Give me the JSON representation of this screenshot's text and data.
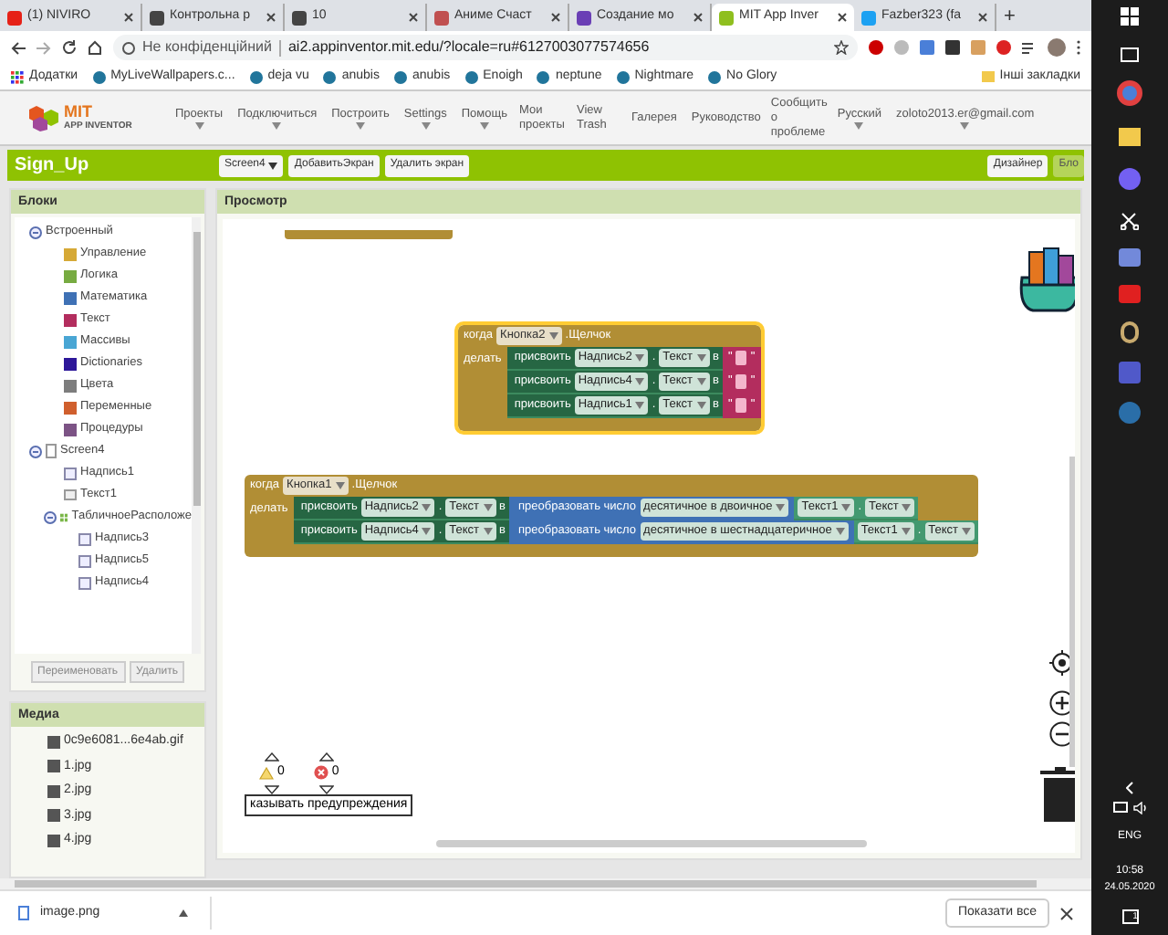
{
  "browser": {
    "tabs": [
      {
        "title": "(1) NIVIRO",
        "selected": false,
        "color": "#e62117"
      },
      {
        "title": "Контрольна р",
        "selected": false,
        "color": "#444444"
      },
      {
        "title": "10",
        "selected": false,
        "color": "#444444"
      },
      {
        "title": "Аниме Счаст",
        "selected": false,
        "color": "#c05050"
      },
      {
        "title": "Создание мо",
        "selected": false,
        "color": "#6a3fb5"
      },
      {
        "title": "MIT App Inver",
        "selected": true,
        "color": "#8fbf1f"
      },
      {
        "title": "Fazber323 (fa",
        "selected": false,
        "color": "#1da1f2"
      }
    ],
    "new_tab": "+",
    "security": "Не конфіденційний",
    "url": "ai2.appinventor.mit.edu/?locale=ru#6127003077574656",
    "apps": "Додатки",
    "bookmarks": [
      "MyLiveWallpapers.c...",
      "deja vu",
      "anubis",
      "anubis",
      "Enoigh",
      "neptune",
      "Nightmare",
      "No Glory"
    ],
    "other_bookmarks": "Інші закладки"
  },
  "app": {
    "logo": {
      "line1": "MIT",
      "line2": "APP INVENTOR"
    },
    "menu": [
      {
        "label": "Проекты",
        "dropdown": true
      },
      {
        "label": "Подключиться",
        "dropdown": true
      },
      {
        "label": "Построить",
        "dropdown": true
      },
      {
        "label": "Settings",
        "dropdown": true
      },
      {
        "label": "Помощь",
        "dropdown": true
      },
      {
        "label": "Мои проекты",
        "dropdown": false
      },
      {
        "label": "View Trash",
        "dropdown": false
      },
      {
        "label": "Галерея",
        "dropdown": false
      },
      {
        "label": "Руководство",
        "dropdown": false
      },
      {
        "label": "Сообщить о проблеме",
        "dropdown": false
      },
      {
        "label": "Русский",
        "dropdown": true
      },
      {
        "label": "zoloto2013.er@gmail.com",
        "dropdown": true
      }
    ]
  },
  "toolbar": {
    "project": "Sign_Up",
    "screen": "Screen4",
    "buttons": [
      "ДобавитьЭкран",
      "Удалить экран"
    ],
    "modes": [
      {
        "label": "Дизайнер",
        "selected": false
      },
      {
        "label": "Бло",
        "selected": true
      }
    ]
  },
  "blocks_panel": {
    "title": "Блоки",
    "tree": [
      {
        "label": "Встроенный",
        "expanded": true,
        "children": [
          {
            "label": "Управление",
            "color": "#d6a936"
          },
          {
            "label": "Логика",
            "color": "#77ab41"
          },
          {
            "label": "Математика",
            "color": "#3f71b5"
          },
          {
            "label": "Текст",
            "color": "#b32d5e"
          },
          {
            "label": "Массивы",
            "color": "#49a6d4"
          },
          {
            "label": "Dictionaries",
            "color": "#2d1799"
          },
          {
            "label": "Цвета",
            "color": "#7d7d7d"
          },
          {
            "label": "Переменные",
            "color": "#d05f2d"
          },
          {
            "label": "Процедуры",
            "color": "#7c5385"
          }
        ]
      },
      {
        "label": "Screen4",
        "kind": "screen",
        "expanded": true,
        "children": [
          {
            "label": "Надпись1",
            "kind": "label"
          },
          {
            "label": "Текст1",
            "kind": "textbox"
          },
          {
            "label": "ТабличноеРасположе",
            "kind": "table",
            "expanded": true,
            "children": [
              {
                "label": "Надпись3",
                "kind": "label"
              },
              {
                "label": "Надпись5",
                "kind": "label"
              },
              {
                "label": "Надпись4",
                "kind": "label"
              }
            ]
          }
        ]
      }
    ],
    "buttons": [
      "Переименовать",
      "Удалить"
    ]
  },
  "media": {
    "title": "Медиа",
    "files": [
      "0c9e6081...6e4ab.gif",
      "1.jpg",
      "2.jpg",
      "3.jpg",
      "4.jpg"
    ]
  },
  "viewer": {
    "title": "Просмотр",
    "events": [
      {
        "when": "когда",
        "component": "Кнопка2",
        "event": ".Щелчок",
        "do": "делать",
        "selected": true,
        "statements": [
          {
            "set": "присвоить",
            "component": "Надпись2",
            "dot": ".",
            "property": "Текст",
            "to": "в",
            "value": {
              "kind": "text",
              "open": "\"",
              "close": "\""
            }
          },
          {
            "set": "присвоить",
            "component": "Надпись4",
            "dot": ".",
            "property": "Текст",
            "to": "в",
            "value": {
              "kind": "text",
              "open": "\"",
              "close": "\""
            }
          },
          {
            "set": "присвоить",
            "component": "Надпись1",
            "dot": ".",
            "property": "Текст",
            "to": "в",
            "value": {
              "kind": "text",
              "open": "\"",
              "close": "\""
            }
          }
        ]
      },
      {
        "when": "когда",
        "component": "Кнопка1",
        "event": ".Щелчок",
        "do": "делать",
        "selected": false,
        "statements": [
          {
            "set": "присвоить",
            "component": "Надпись2",
            "dot": ".",
            "property": "Текст",
            "to": "в",
            "value": {
              "kind": "convert",
              "label": "преобразовать число",
              "mode": "десятичное в двоичное",
              "component": "Текст1",
              "dot": ".",
              "property": "Текст"
            }
          },
          {
            "set": "присвоить",
            "component": "Надпись4",
            "dot": ".",
            "property": "Текст",
            "to": "в",
            "value": {
              "kind": "convert",
              "label": "преобразовать число",
              "mode": "десятичное в шестнадцатеричное",
              "component": "Текст1",
              "dot": ".",
              "property": "Текст"
            }
          }
        ]
      }
    ],
    "warnings": "0",
    "errors": "0",
    "warnings_toggle": "казывать предупреждения"
  },
  "downloads": {
    "file": "image.png",
    "show_all": "Показати все"
  },
  "taskbar": {
    "language": "ENG",
    "time": "10:58",
    "date": "24.05.2020",
    "notifications": "1"
  }
}
